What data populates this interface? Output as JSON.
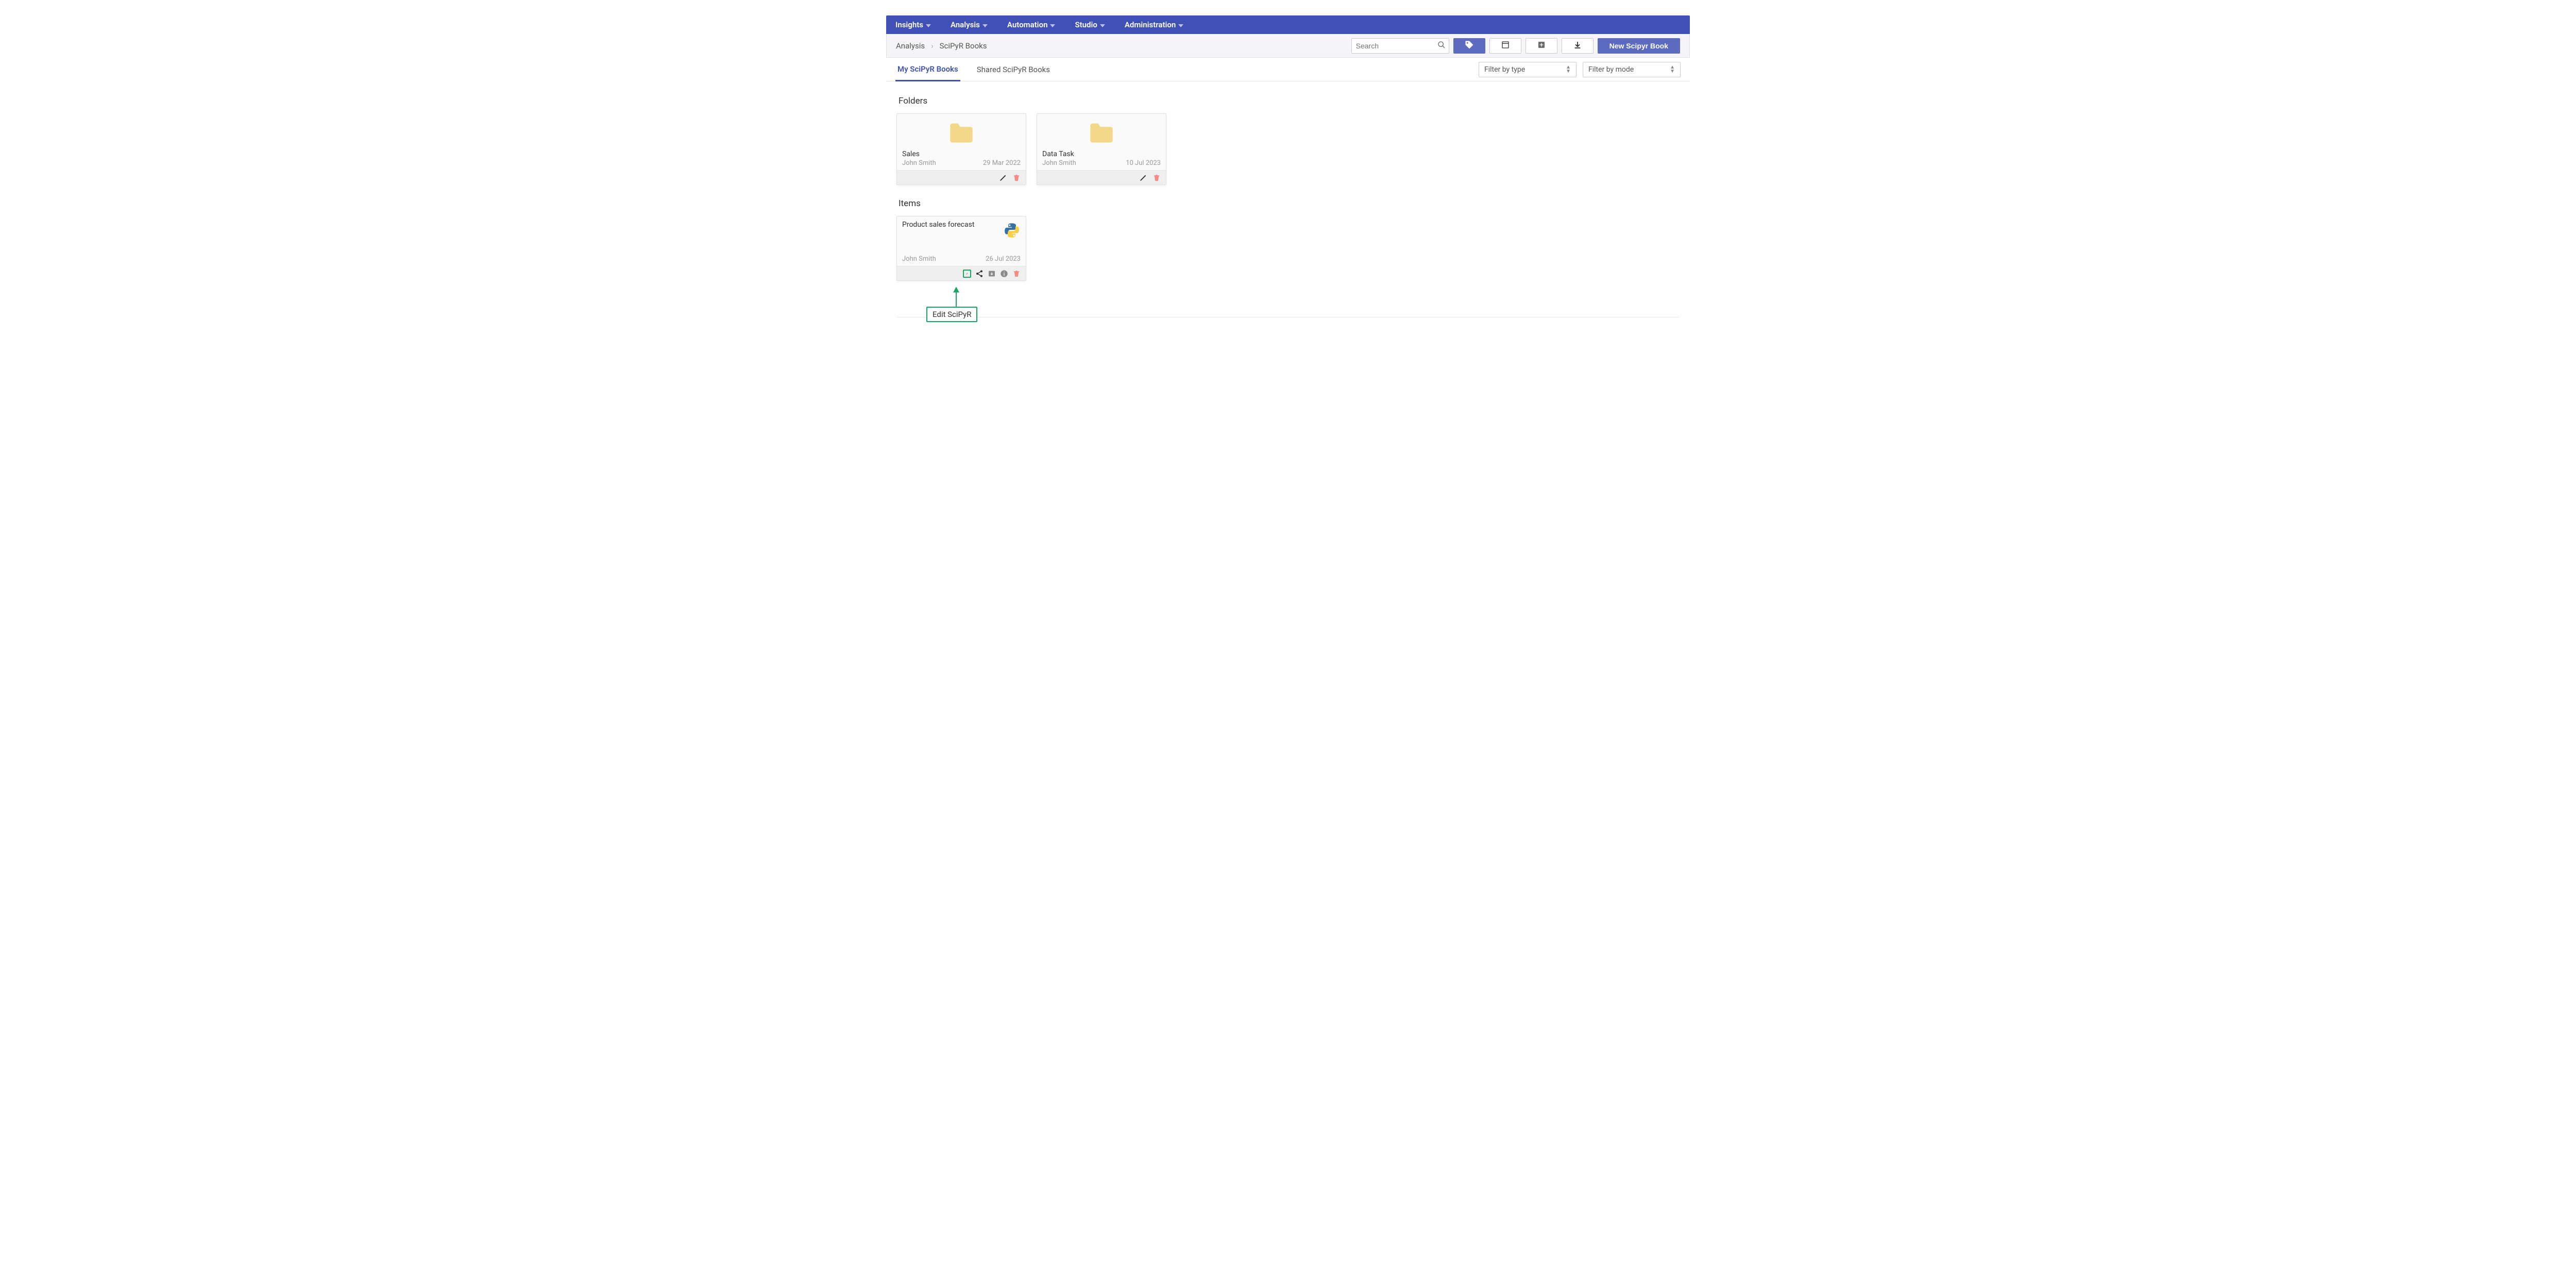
{
  "nav": {
    "items": [
      "Insights",
      "Analysis",
      "Automation",
      "Studio",
      "Administration"
    ]
  },
  "breadcrumbs": [
    "Analysis",
    "SciPyR Books"
  ],
  "search": {
    "placeholder": "Search"
  },
  "new_book_label": "New Scipyr Book",
  "tabs": {
    "my_books": "My SciPyR Books",
    "shared_books": "Shared SciPyR Books"
  },
  "filters": {
    "by_type": "Filter by type",
    "by_mode": "Filter by mode"
  },
  "sections": {
    "folders_title": "Folders",
    "items_title": "Items"
  },
  "folders": [
    {
      "name": "Sales",
      "owner": "John Smith",
      "date": "29 Mar 2022"
    },
    {
      "name": "Data Task",
      "owner": "John Smith",
      "date": "10 Jul 2023"
    }
  ],
  "items": [
    {
      "name": "Product sales forecast",
      "owner": "John Smith",
      "date": "26 Jul 2023"
    }
  ],
  "annotation": {
    "edit_label": "Edit SciPyR"
  }
}
